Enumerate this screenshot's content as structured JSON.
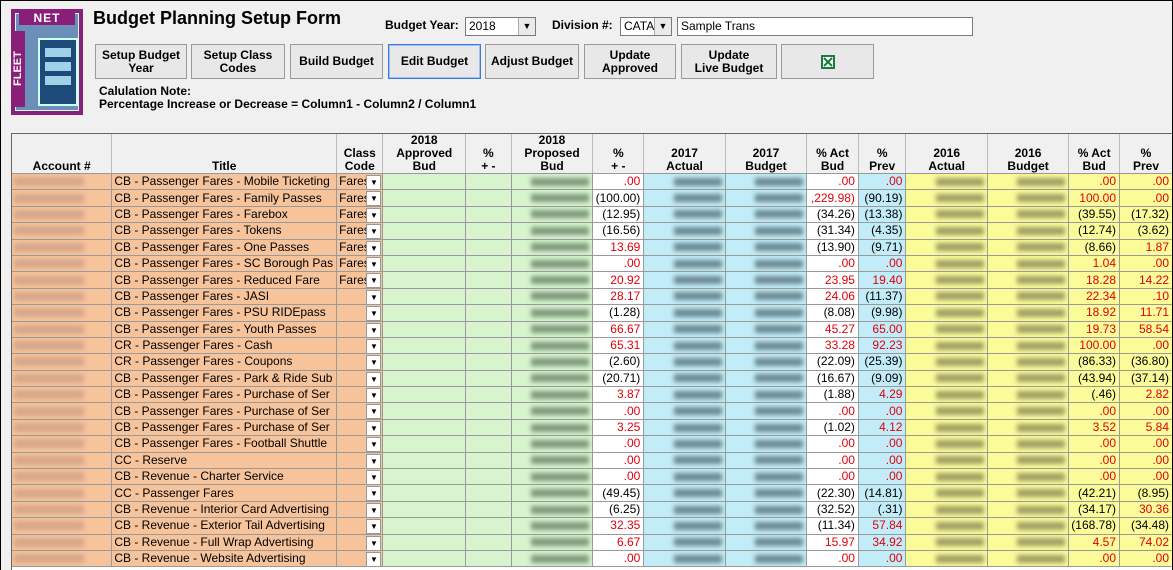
{
  "header": {
    "title": "Budget Planning Setup Form",
    "budget_year_label": "Budget Year:",
    "budget_year_value": "2018",
    "division_label": "Division #:",
    "division_value": "CATA",
    "division_name": "Sample Trans"
  },
  "logo": {
    "top_text": "NET",
    "side_text": "FLEET"
  },
  "toolbar": {
    "setup_budget_year": "Setup Budget\nYear",
    "setup_class_codes": "Setup Class\nCodes",
    "build_budget": "Build Budget",
    "edit_budget": "Edit Budget",
    "adjust_budget": "Adjust Budget",
    "update_approved": "Update\nApproved",
    "update_live_budget": "Update\nLive Budget",
    "excel_icon": "excel-icon"
  },
  "note": {
    "line1": "Calulation Note:",
    "line2": "Percentage Increase or Decrease =  Column1 - Column2 / Column1"
  },
  "colors": {
    "account_bg": "#f6c39b",
    "approved_bg": "#d7f4cf",
    "actual_bg": "#c2ecf7",
    "yr2016_bg": "#fbfb9a",
    "positive": "#e0000a"
  },
  "grid": {
    "headers": {
      "account": "Account #",
      "title": "Title",
      "class_code": "Class\nCode",
      "approved_2018": "2018\nApproved Bud",
      "pct1": "%\n+ -",
      "proposed_2018": "2018\nProposed Bud",
      "pct2": "%\n+ -",
      "actual_2017": "2017\nActual",
      "budget_2017": "2017\nBudget",
      "act_bud_2017": "% Act\nBud",
      "prev_2017": "%\nPrev",
      "actual_2016": "2016\nActual",
      "budget_2016": "2016\nBudget",
      "act_bud_2016": "% Act\nBud",
      "prev_2016": "%\nPrev"
    },
    "rows": [
      {
        "title": "CB - Passenger Fares - Mobile Ticketing",
        "cls": "Fares",
        "p": ".00",
        "ab17": ".00",
        "pv17": ".00",
        "ab16": ".00",
        "pv16": ".00"
      },
      {
        "title": "CB - Passenger Fares - Family Passes",
        "cls": "Fares",
        "p": "(100.00)",
        "ab17": ",229.98)",
        "pv17": "(90.19)",
        "ab16": "100.00",
        "pv16": ".00"
      },
      {
        "title": "CB - Passenger Fares - Farebox",
        "cls": "Fares",
        "p": "(12.95)",
        "ab17": "(34.26)",
        "pv17": "(13.38)",
        "ab16": "(39.55)",
        "pv16": "(17.32)"
      },
      {
        "title": "CB - Passenger Fares - Tokens",
        "cls": "Fares",
        "p": "(16.56)",
        "ab17": "(31.34)",
        "pv17": "(4.35)",
        "ab16": "(12.74)",
        "pv16": "(3.62)"
      },
      {
        "title": "CB - Passenger Fares - One Passes",
        "cls": "Fares",
        "p": "13.69",
        "ab17": "(13.90)",
        "pv17": "(9.71)",
        "ab16": "(8.66)",
        "pv16": "1.87"
      },
      {
        "title": "CB - Passenger Fares - SC Borough Pas",
        "cls": "Fares",
        "p": ".00",
        "ab17": ".00",
        "pv17": ".00",
        "ab16": "1.04",
        "pv16": ".00"
      },
      {
        "title": "CB - Passenger Fares - Reduced Fare",
        "cls": "Fares",
        "p": "20.92",
        "ab17": "23.95",
        "pv17": "19.40",
        "ab16": "18.28",
        "pv16": "14.22"
      },
      {
        "title": "CB - Passenger Fares - JASI",
        "cls": "",
        "p": "28.17",
        "ab17": "24.06",
        "pv17": "(11.37)",
        "ab16": "22.34",
        "pv16": ".10"
      },
      {
        "title": "CB - Passenger Fares - PSU RIDEpass",
        "cls": "",
        "p": "(1.28)",
        "ab17": "(8.08)",
        "pv17": "(9.98)",
        "ab16": "18.92",
        "pv16": "11.71"
      },
      {
        "title": "CB - Passenger Fares - Youth Passes",
        "cls": "",
        "p": "66.67",
        "ab17": "45.27",
        "pv17": "65.00",
        "ab16": "19.73",
        "pv16": "58.54"
      },
      {
        "title": "CR - Passenger Fares - Cash",
        "cls": "",
        "p": "65.31",
        "ab17": "33.28",
        "pv17": "92.23",
        "ab16": "100.00",
        "pv16": ".00"
      },
      {
        "title": "CR - Passenger Fares - Coupons",
        "cls": "",
        "p": "(2.60)",
        "ab17": "(22.09)",
        "pv17": "(25.39)",
        "ab16": "(86.33)",
        "pv16": "(36.80)"
      },
      {
        "title": "CB - Passenger Fares - Park & Ride Sub",
        "cls": "",
        "p": "(20.71)",
        "ab17": "(16.67)",
        "pv17": "(9.09)",
        "ab16": "(43.94)",
        "pv16": "(37.14)"
      },
      {
        "title": "CB - Passenger Fares - Purchase of Ser",
        "cls": "",
        "p": "3.87",
        "ab17": "(1.88)",
        "pv17": "4.29",
        "ab16": "(.46)",
        "pv16": "2.82"
      },
      {
        "title": "CB - Passenger Fares - Purchase of Ser",
        "cls": "",
        "p": ".00",
        "ab17": ".00",
        "pv17": ".00",
        "ab16": ".00",
        "pv16": ".00"
      },
      {
        "title": "CB - Passenger Fares - Purchase of Ser",
        "cls": "",
        "p": "3.25",
        "ab17": "(1.02)",
        "pv17": "4.12",
        "ab16": "3.52",
        "pv16": "5.84"
      },
      {
        "title": "CB - Passenger Fares - Football Shuttle",
        "cls": "",
        "p": ".00",
        "ab17": ".00",
        "pv17": ".00",
        "ab16": ".00",
        "pv16": ".00"
      },
      {
        "title": "CC - Reserve",
        "cls": "",
        "p": ".00",
        "ab17": ".00",
        "pv17": ".00",
        "ab16": ".00",
        "pv16": ".00"
      },
      {
        "title": "CB - Revenue - Charter Service",
        "cls": "",
        "p": ".00",
        "ab17": ".00",
        "pv17": ".00",
        "ab16": ".00",
        "pv16": ".00"
      },
      {
        "title": "CC - Passenger Fares",
        "cls": "",
        "p": "(49.45)",
        "ab17": "(22.30)",
        "pv17": "(14.81)",
        "ab16": "(42.21)",
        "pv16": "(8.95)"
      },
      {
        "title": "CB - Revenue - Interior Card Advertising",
        "cls": "",
        "p": "(6.25)",
        "ab17": "(32.52)",
        "pv17": "(.31)",
        "ab16": "(34.17)",
        "pv16": "30.36"
      },
      {
        "title": "CB - Revenue - Exterior Tail Advertising",
        "cls": "",
        "p": "32.35",
        "ab17": "(11.34)",
        "pv17": "57.84",
        "ab16": "(168.78)",
        "pv16": "(34.48)"
      },
      {
        "title": "CB - Revenue - Full Wrap Advertising",
        "cls": "",
        "p": "6.67",
        "ab17": "15.97",
        "pv17": "34.92",
        "ab16": "4.57",
        "pv16": "74.02"
      },
      {
        "title": "CB - Revenue - Website Advertising",
        "cls": "",
        "p": ".00",
        "ab17": ".00",
        "pv17": ".00",
        "ab16": ".00",
        "pv16": ".00"
      }
    ]
  }
}
